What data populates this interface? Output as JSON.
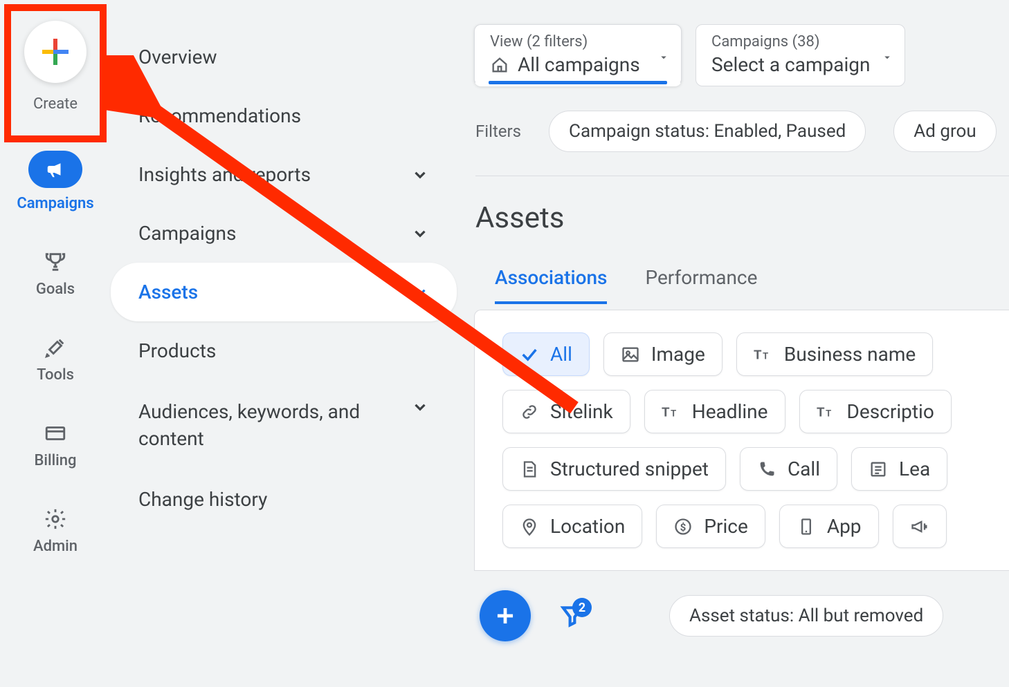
{
  "rail": {
    "create_label": "Create",
    "items": [
      {
        "label": "Campaigns",
        "active": true
      },
      {
        "label": "Goals"
      },
      {
        "label": "Tools"
      },
      {
        "label": "Billing"
      },
      {
        "label": "Admin"
      }
    ]
  },
  "nav2": {
    "items": [
      {
        "label": "Overview",
        "expandable": false
      },
      {
        "label": "Recommendations",
        "expandable": false
      },
      {
        "label": "Insights and reports",
        "expandable": true
      },
      {
        "label": "Campaigns",
        "expandable": true
      },
      {
        "label": "Assets",
        "expandable": true,
        "selected": true
      },
      {
        "label": "Products",
        "expandable": false
      },
      {
        "label": "Audiences, keywords, and content",
        "expandable": true,
        "multiline": true
      },
      {
        "label": "Change history",
        "expandable": false
      }
    ]
  },
  "selectors": {
    "view": {
      "top": "View (2 filters)",
      "bottom": "All campaigns"
    },
    "campaign": {
      "top": "Campaigns (38)",
      "bottom": "Select a campaign"
    }
  },
  "filters": {
    "label": "Filters",
    "chips": [
      "Campaign status: Enabled, Paused",
      "Ad grou"
    ]
  },
  "page_title": "Assets",
  "tabs": [
    {
      "label": "Associations",
      "active": true
    },
    {
      "label": "Performance"
    }
  ],
  "asset_chips": {
    "row1": [
      {
        "label": "All",
        "icon": "check",
        "active": true
      },
      {
        "label": "Image",
        "icon": "image"
      },
      {
        "label": "Business name",
        "icon": "tt"
      }
    ],
    "row2": [
      {
        "label": "Sitelink",
        "icon": "link"
      },
      {
        "label": "Headline",
        "icon": "tt"
      },
      {
        "label": "Descriptio",
        "icon": "tt"
      }
    ],
    "row3": [
      {
        "label": "Structured snippet",
        "icon": "doc"
      },
      {
        "label": "Call",
        "icon": "phone"
      },
      {
        "label": "Lea",
        "icon": "list"
      }
    ],
    "row4": [
      {
        "label": "Location",
        "icon": "pin"
      },
      {
        "label": "Price",
        "icon": "dollar"
      },
      {
        "label": "App",
        "icon": "mobile"
      },
      {
        "label": "",
        "icon": "megaphone"
      }
    ]
  },
  "bottom_bar": {
    "filter_badge": "2",
    "status_chip": "Asset status: All but removed"
  },
  "annotation": {
    "present": true
  }
}
